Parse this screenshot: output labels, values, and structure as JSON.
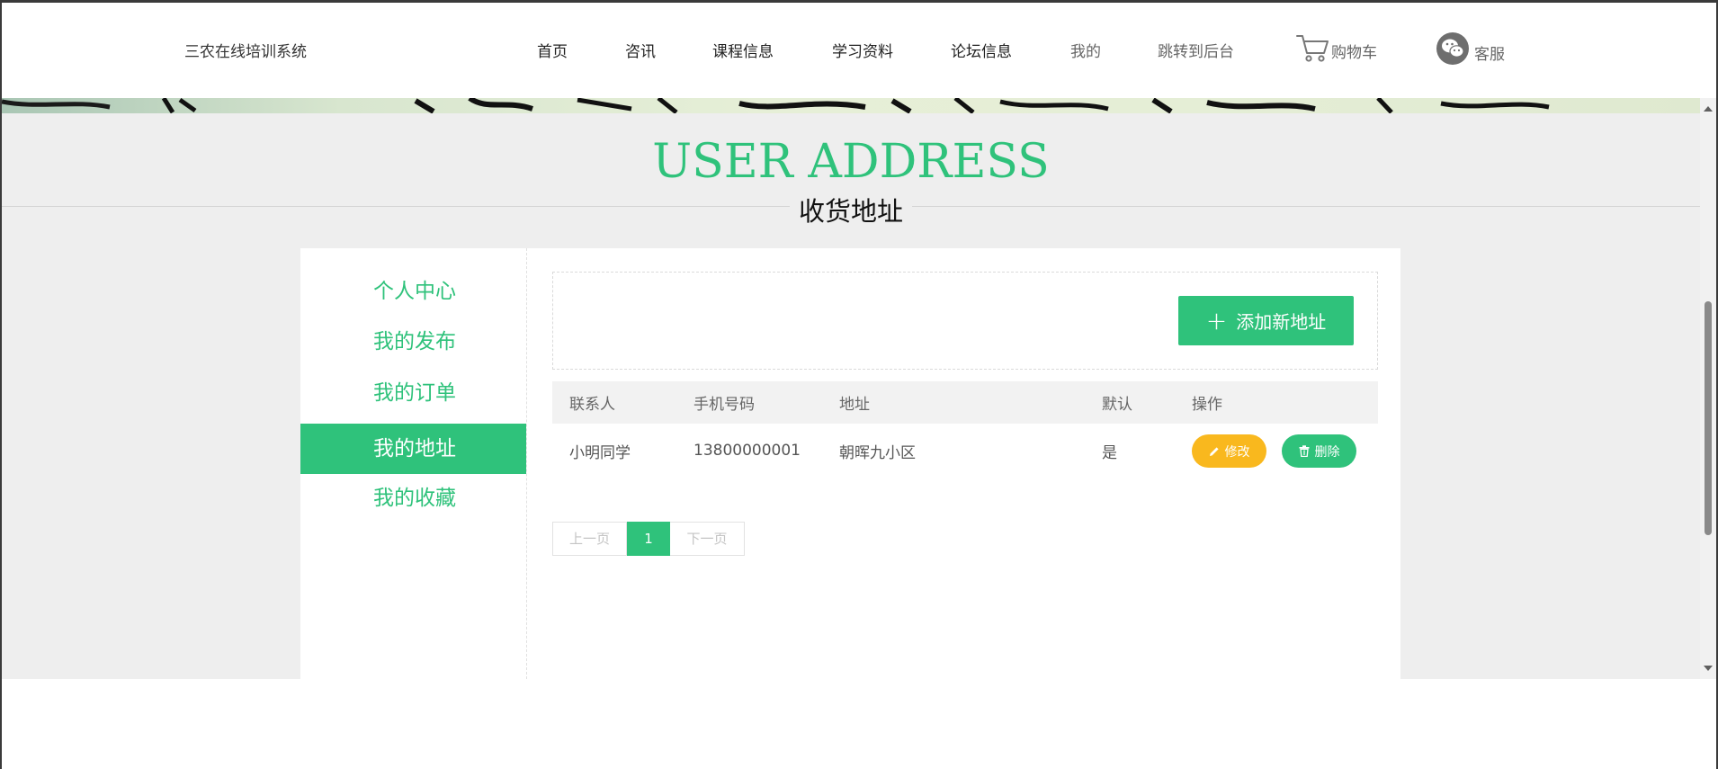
{
  "header": {
    "brand": "三农在线培训系统",
    "nav": [
      {
        "label": "首页",
        "muted": false
      },
      {
        "label": "咨讯",
        "muted": false
      },
      {
        "label": "课程信息",
        "muted": false
      },
      {
        "label": "学习资料",
        "muted": false
      },
      {
        "label": "论坛信息",
        "muted": false
      },
      {
        "label": "我的",
        "muted": true
      },
      {
        "label": "跳转到后台",
        "muted": true
      }
    ],
    "cart_label": "购物车",
    "service_label": "客服"
  },
  "page": {
    "title_en": "USER ADDRESS",
    "title_cn": "收货地址"
  },
  "sidebar": {
    "items": [
      {
        "label": "个人中心",
        "active": false
      },
      {
        "label": "我的发布",
        "active": false
      },
      {
        "label": "我的订单",
        "active": false
      },
      {
        "label": "我的地址",
        "active": true
      },
      {
        "label": "我的收藏",
        "active": false
      }
    ]
  },
  "toolbar": {
    "add_label": "添加新地址"
  },
  "table": {
    "headers": [
      "联系人",
      "手机号码",
      "地址",
      "默认",
      "操作"
    ],
    "rows": [
      {
        "contact": "小明同学",
        "phone": "13800000001",
        "address": "朝晖九小区",
        "default": "是",
        "edit_label": "修改",
        "delete_label": "删除"
      }
    ]
  },
  "pagination": {
    "prev": "上一页",
    "current": "1",
    "next": "下一页"
  },
  "colors": {
    "accent": "#2fc27b",
    "warning": "#f9b81e",
    "background": "#eeeeee"
  }
}
